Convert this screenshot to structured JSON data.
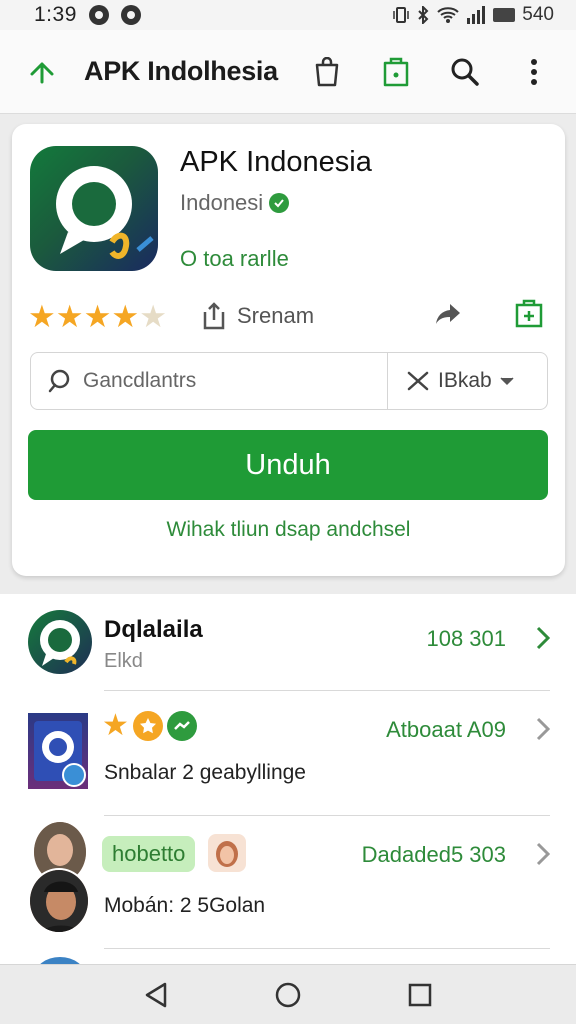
{
  "status_bar": {
    "time": "1:39",
    "battery_text": "540",
    "icons": [
      "notification-icon",
      "notification-icon",
      "vibrate-icon",
      "bluetooth-icon",
      "wifi-icon",
      "signal-icon",
      "battery-icon"
    ]
  },
  "app_bar": {
    "title": "APK Indolhesia",
    "icons": [
      "back-icon",
      "bag-icon",
      "save-icon",
      "search-icon",
      "more-vert-icon"
    ]
  },
  "app": {
    "name": "APK Indonesia",
    "developer": "Indonesi",
    "installs": "O toa rarlle",
    "rating_value": 4.5,
    "rating_max": 5,
    "share_label": "Srenam",
    "search_placeholder": "Gancdlantrs",
    "filter_label": "IBkab",
    "download_label": "Unduh",
    "hint": "Wihak tliun dsap andchsel"
  },
  "list": [
    {
      "name": "Dqlalaila",
      "subtitle": "Elkd",
      "meta": "108 301"
    },
    {
      "caption": "Snbalar 2 geabyllinge",
      "meta": "Atboaat A09"
    },
    {
      "tag": "hobetto",
      "caption": "Mobán: 2 5Golan",
      "meta": "Dadaded5 303"
    }
  ],
  "colors": {
    "accent": "#1f9b36",
    "accent_text": "#2e8b3a",
    "star": "#f5a623"
  }
}
